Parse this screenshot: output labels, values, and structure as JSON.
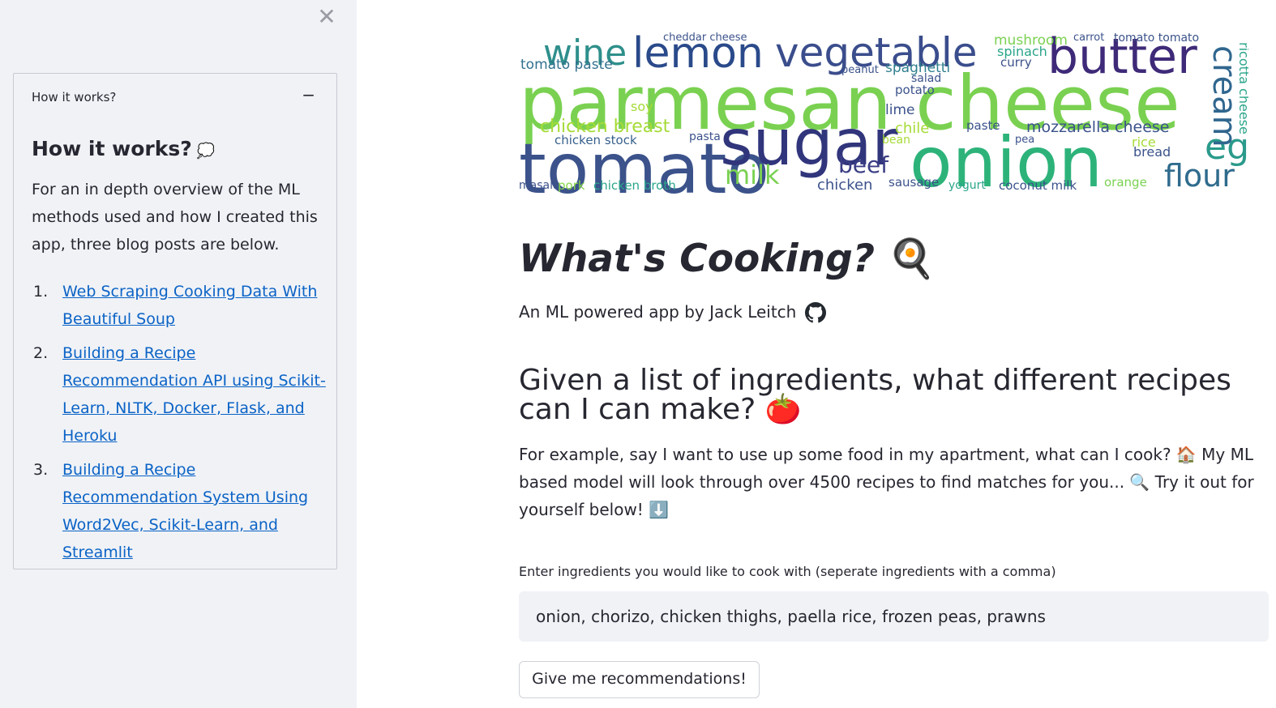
{
  "sidebar": {
    "close_symbol": "✕",
    "expander": {
      "header": "How it works?",
      "toggle": "−",
      "title": "How it works?",
      "title_emoji": "💭",
      "intro": "For an in depth overview of the ML methods used and how I created this app, three blog posts are below.",
      "links": [
        {
          "num": "1.",
          "label": "Web Scraping Cooking Data With Beautiful Soup"
        },
        {
          "num": "2.",
          "label": "Building a Recipe Recommendation API using Scikit-Learn, NLTK, Docker, Flask, and Heroku"
        },
        {
          "num": "3.",
          "label": "Building a Recipe Recommendation System Using Word2Vec, Scikit-Learn, and Streamlit"
        }
      ]
    }
  },
  "main": {
    "wordcloud_words": [
      {
        "w": "parmesan cheese",
        "c": "#7ad151"
      },
      {
        "w": "tomato",
        "c": "#3b528b"
      },
      {
        "w": "sugar",
        "c": "#31357b"
      },
      {
        "w": "onion",
        "c": "#2db37a"
      },
      {
        "w": "butter",
        "c": "#3e2a78"
      },
      {
        "w": "vegetable",
        "c": "#3a4d8c"
      },
      {
        "w": "lemon",
        "c": "#2a4a8a"
      },
      {
        "w": "wine",
        "c": "#2e8f8b"
      },
      {
        "w": "egg",
        "c": "#2a9a8b"
      },
      {
        "w": "cream",
        "c": "#30668e"
      },
      {
        "w": "flour",
        "c": "#2f6b8d"
      },
      {
        "w": "milk",
        "c": "#7ad151"
      },
      {
        "w": "beef",
        "c": "#3b3e85"
      },
      {
        "w": "chicken breast",
        "c": "#a5db36"
      },
      {
        "w": "tomato paste",
        "c": "#31718e"
      },
      {
        "w": "mozzarella cheese",
        "c": "#3b528b"
      },
      {
        "w": "spaghetti",
        "c": "#2f7f8e"
      },
      {
        "w": "chicken",
        "c": "#3b528b"
      },
      {
        "w": "ricotta cheese",
        "c": "#2aa58a"
      },
      {
        "w": "mushroom",
        "c": "#7ad151"
      },
      {
        "w": "chicken stock",
        "c": "#37608d"
      },
      {
        "w": "chicken broth",
        "c": "#2aa58a"
      },
      {
        "w": "pork",
        "c": "#86d549"
      },
      {
        "w": "masala",
        "c": "#3b528b"
      },
      {
        "w": "lime",
        "c": "#3b528b"
      },
      {
        "w": "potato",
        "c": "#3b528b"
      },
      {
        "w": "paste",
        "c": "#3b528b"
      },
      {
        "w": "chile",
        "c": "#a5db36"
      },
      {
        "w": "coconut milk",
        "c": "#3b528b"
      },
      {
        "w": "sausage",
        "c": "#3b528b"
      },
      {
        "w": "yogurt",
        "c": "#2aa58a"
      },
      {
        "w": "orange",
        "c": "#7ad151"
      },
      {
        "w": "rice",
        "c": "#a5db36"
      },
      {
        "w": "bread",
        "c": "#3b528b"
      },
      {
        "w": "spinach",
        "c": "#2aa58a"
      },
      {
        "w": "curry",
        "c": "#3b528b"
      },
      {
        "w": "carrot",
        "c": "#3b528b"
      },
      {
        "w": "tomato tomato",
        "c": "#3b528b"
      },
      {
        "w": "cheddar cheese",
        "c": "#3b528b"
      },
      {
        "w": "soy",
        "c": "#a5db36"
      },
      {
        "w": "salad",
        "c": "#3b528b"
      },
      {
        "w": "peanut",
        "c": "#3b528b"
      },
      {
        "w": "pasta",
        "c": "#3b528b"
      },
      {
        "w": "bean",
        "c": "#a5db36"
      },
      {
        "w": "pea",
        "c": "#3b528b"
      }
    ],
    "title": "What's Cooking?",
    "title_emoji": "🍳",
    "subtitle": "An ML powered app by Jack Leitch",
    "heading": "Given a list of ingredients, what different recipes can I can make?",
    "heading_emoji": "🍅",
    "paragraph": "For example, say I want to use up some food in my apartment, what can I cook? 🏠 My ML based model will look through over 4500 recipes to find matches for you... 🔍 Try it out for yourself below! ⬇️",
    "input_label": "Enter ingredients you would like to cook with (seperate ingredients with a comma)",
    "input_value": "onion, chorizo, chicken thighs, paella rice, frozen peas, prawns",
    "button_label": "Give me recommendations!"
  }
}
